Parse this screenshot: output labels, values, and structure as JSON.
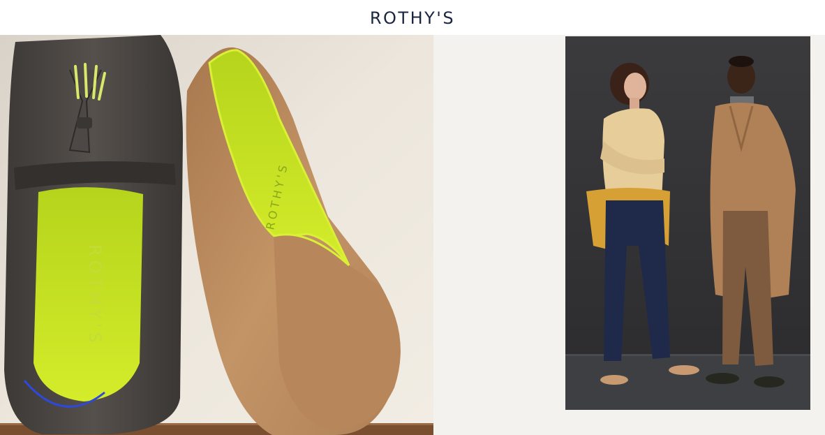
{
  "header": {
    "logo_text": "ROTHY'S"
  },
  "hero": {
    "left_image": {
      "subject": "shoes-photo",
      "insole_print": "ROTHY'S"
    },
    "right_image": {
      "subject": "models-photo"
    }
  },
  "colors": {
    "brand_navy": "#1a2540",
    "panel_background": "#f3f2ee",
    "lime_accent": "#c9e21f",
    "camel": "#b9875a",
    "charcoal_knit": "#4a4542"
  }
}
